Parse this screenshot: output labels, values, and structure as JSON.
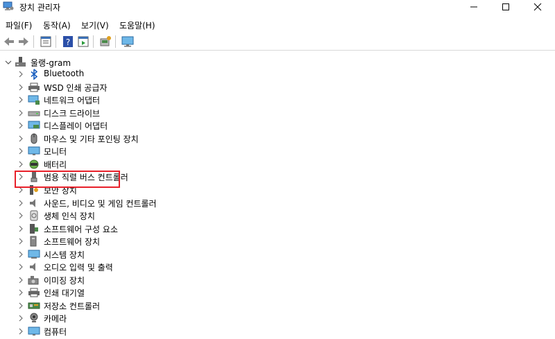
{
  "window": {
    "title": "장치 관리자",
    "app_icon": "device-manager-icon"
  },
  "menu": [
    {
      "label": "파일(F)"
    },
    {
      "label": "동작(A)"
    },
    {
      "label": "보기(V)"
    },
    {
      "label": "도움말(H)"
    }
  ],
  "toolbar": {
    "buttons": [
      "back-arrow-icon",
      "forward-arrow-icon",
      "properties-icon",
      "help-icon",
      "action-view-icon",
      "scan-hardware-icon",
      "monitor-icon"
    ]
  },
  "tree": {
    "root_label": "울랭-gram",
    "nodes": [
      {
        "label": "Bluetooth",
        "icon": "bluetooth-icon"
      },
      {
        "label": "WSD 인쇄 공급자",
        "icon": "printer-icon"
      },
      {
        "label": "네트워크 어댑터",
        "icon": "network-adapter-icon"
      },
      {
        "label": "디스크 드라이브",
        "icon": "disk-drive-icon"
      },
      {
        "label": "디스플레이 어댑터",
        "icon": "display-adapter-icon"
      },
      {
        "label": "마우스 및 기타 포인팅 장치",
        "icon": "mouse-icon"
      },
      {
        "label": "모니터",
        "icon": "monitor-icon"
      },
      {
        "label": "배터리",
        "icon": "battery-icon"
      },
      {
        "label": "범용 직렬 버스 컨트롤러",
        "icon": "usb-icon"
      },
      {
        "label": "보안 장치",
        "icon": "security-device-icon"
      },
      {
        "label": "사운드, 비디오 및 게임 컨트롤러",
        "icon": "sound-icon"
      },
      {
        "label": "생체 인식 장치",
        "icon": "biometric-icon"
      },
      {
        "label": "소프트웨어 구성 요소",
        "icon": "software-component-icon"
      },
      {
        "label": "소프트웨어 장치",
        "icon": "software-device-icon"
      },
      {
        "label": "시스템 장치",
        "icon": "system-device-icon"
      },
      {
        "label": "오디오 입력 및 출력",
        "icon": "audio-io-icon"
      },
      {
        "label": "이미징 장치",
        "icon": "camera-imaging-icon"
      },
      {
        "label": "인쇄 대기열",
        "icon": "print-queue-icon"
      },
      {
        "label": "저장소 컨트롤러",
        "icon": "storage-controller-icon"
      },
      {
        "label": "카메라",
        "icon": "webcam-icon"
      },
      {
        "label": "컴퓨터",
        "icon": "computer-icon"
      }
    ]
  },
  "highlight_color": "#e8202a"
}
